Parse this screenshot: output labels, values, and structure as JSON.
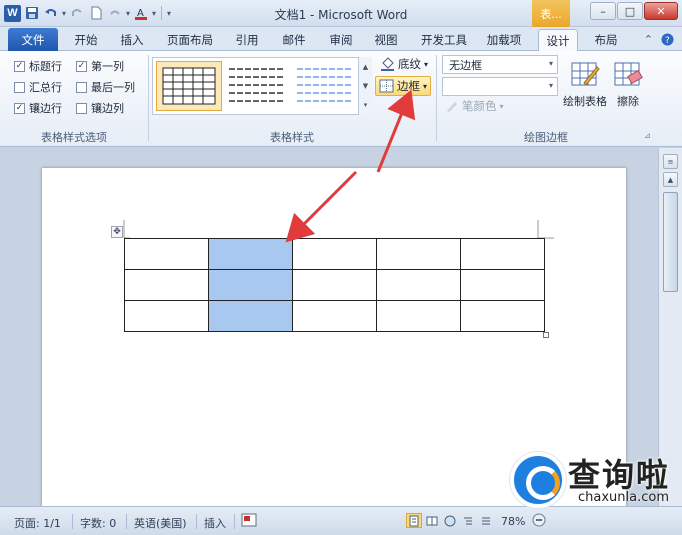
{
  "window": {
    "title": "文档1 - Microsoft Word",
    "app_logo": "W",
    "context_tab": "表...",
    "buttons": {
      "minimize": "–",
      "maximize": "□",
      "close": "✕"
    }
  },
  "tabs": [
    {
      "label": "文件"
    },
    {
      "label": "开始"
    },
    {
      "label": "插入"
    },
    {
      "label": "页面布局"
    },
    {
      "label": "引用"
    },
    {
      "label": "邮件"
    },
    {
      "label": "审阅"
    },
    {
      "label": "视图"
    },
    {
      "label": "开发工具"
    },
    {
      "label": "加载项"
    },
    {
      "label": "设计"
    },
    {
      "label": "布局"
    }
  ],
  "ribbon": {
    "style_options": {
      "label": "表格样式选项",
      "items": [
        {
          "label": "标题行",
          "checked": true
        },
        {
          "label": "第一列",
          "checked": true
        },
        {
          "label": "汇总行",
          "checked": false
        },
        {
          "label": "最后一列",
          "checked": false
        },
        {
          "label": "镶边行",
          "checked": true
        },
        {
          "label": "镶边列",
          "checked": false
        }
      ]
    },
    "table_styles": {
      "label": "表格样式",
      "shading_label": "底纹",
      "border_label": "边框"
    },
    "draw_borders": {
      "label": "绘图边框",
      "border_style": "无边框",
      "line_weight": "",
      "pen_color_label": "笔颜色",
      "draw_table_label": "绘制表格",
      "eraser_label": "擦除"
    }
  },
  "document": {
    "table": {
      "rows": 3,
      "cols": 5,
      "selected_col": 1
    }
  },
  "status": {
    "page": "页面: 1/1",
    "words": "字数: 0",
    "language": "英语(美国)",
    "mode": "插入",
    "zoom": "78%"
  },
  "watermark": {
    "cn": "查询啦",
    "en": "chaxunla.com"
  },
  "colors": {
    "file_tab": "#2a62b8",
    "selection": "#a9c8ef",
    "annotation_arrow": "#e23b3b",
    "context_tab": "#eeb240"
  }
}
